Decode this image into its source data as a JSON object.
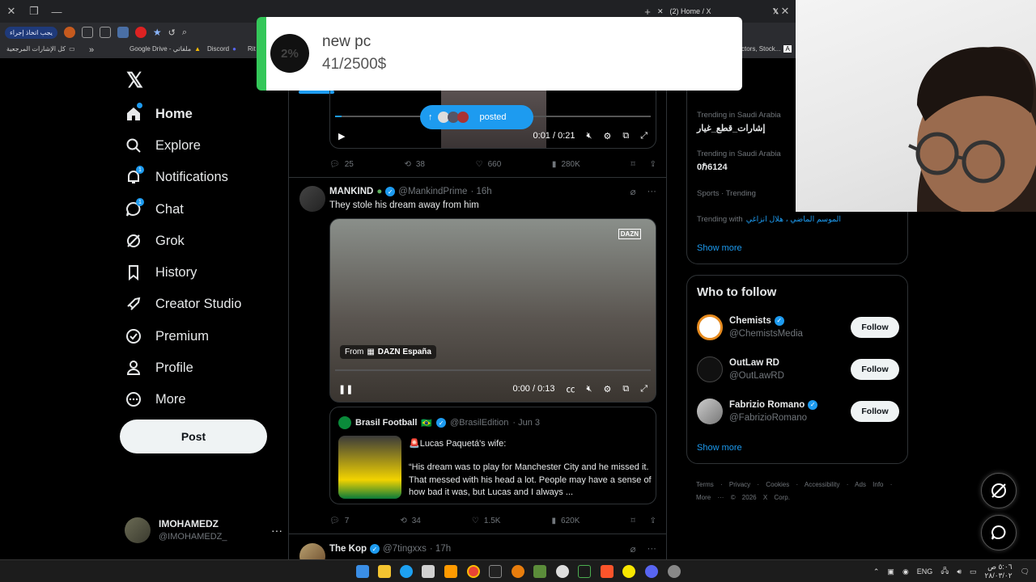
{
  "browser": {
    "tab_title": "(2) Home / X",
    "action_button": "يجب اتخاذ إجراء",
    "bookmarks": [
      "كل الإشارات المرجعية",
      "»",
      "Google Drive - ملفاتي",
      "Discord",
      "Rit",
      "ctors, Stock..."
    ]
  },
  "donation": {
    "percent": "2%",
    "title": "new pc",
    "amount": "41/2500$",
    "progress": 0.016
  },
  "nav": {
    "logo": "𝕏",
    "items": [
      {
        "label": "Home",
        "icon": "home-icon",
        "active": true
      },
      {
        "label": "Explore",
        "icon": "search-icon"
      },
      {
        "label": "Notifications",
        "icon": "bell-icon",
        "badge": "1"
      },
      {
        "label": "Chat",
        "icon": "chat-icon",
        "badge": "1"
      },
      {
        "label": "Grok",
        "icon": "grok-icon"
      },
      {
        "label": "History",
        "icon": "bookmark-icon"
      },
      {
        "label": "Creator Studio",
        "icon": "rocket-icon"
      },
      {
        "label": "Premium",
        "icon": "premium-icon"
      },
      {
        "label": "Profile",
        "icon": "person-icon"
      },
      {
        "label": "More",
        "icon": "more-circle-icon"
      }
    ],
    "post_label": "Post",
    "user_name": "IMOHAMEDZ",
    "user_handle": "@IMOHAMEDZ_"
  },
  "feed": {
    "posted_label": "posted",
    "tweet1": {
      "time": "0:01 / 0:21",
      "replies": "25",
      "retweets": "38",
      "likes": "660",
      "views": "280K"
    },
    "tweet2": {
      "name": "MANKIND",
      "handle": "@MankindPrime",
      "age": "· 16h",
      "text": "They stole his dream away from him",
      "video_source_prefix": "From",
      "video_source": "DAZN España",
      "video_watermark": "DAZN",
      "time": "0:00 / 0:13",
      "quote": {
        "name": "Brasil Football",
        "flag": "🇧🇷",
        "handle": "@BrasilEdition",
        "age": "· Jun 3",
        "lead": "🚨Lucas Paquetá's wife:",
        "text": "“His dream was to play for Manchester City and he missed it. That messed with his head a lot. People may have a sense of how bad it was, but Lucas and I always ..."
      },
      "replies": "7",
      "retweets": "34",
      "likes": "1.5K",
      "views": "620K"
    },
    "tweet3": {
      "name": "The Kop",
      "handle": "@7tingxxs",
      "age": "· 17h"
    }
  },
  "trends": [
    {
      "context": "Trending in Saudi Arabia",
      "topic": "إشارات_قطع_غيار"
    },
    {
      "context": "Trending in Saudi Arabia",
      "topic": "0ℏ6124"
    },
    {
      "context": "Sports · Trending",
      "topic": ""
    },
    {
      "context": "Trending with",
      "topic": "الموسم الماضي ، هلال انزاغي"
    }
  ],
  "trends_show_more": "Show more",
  "who_to_follow": {
    "title": "Who to follow",
    "accounts": [
      {
        "name": "Chemists",
        "handle": "@ChemistsMedia",
        "verified": true
      },
      {
        "name": "OutLaw RD",
        "handle": "@OutLawRD",
        "verified": false
      },
      {
        "name": "Fabrizio Romano",
        "handle": "@FabrizioRomano",
        "verified": true
      }
    ],
    "follow_label": "Follow",
    "show_more": "Show more"
  },
  "footer": {
    "links": [
      "Terms",
      "·",
      "Privacy",
      "·",
      "Cookies",
      "·",
      "Accessibility",
      "·",
      "Ads Info",
      "·",
      "More ···"
    ],
    "copyright": "© 2026 X Corp."
  },
  "taskbar": {
    "lang": "ENG",
    "time": "٥:٠٦ ص",
    "date": "٢٨/٠٣/٠٢"
  },
  "colors": {
    "accent": "#1d9bf0",
    "donation_green": "#34c759"
  }
}
